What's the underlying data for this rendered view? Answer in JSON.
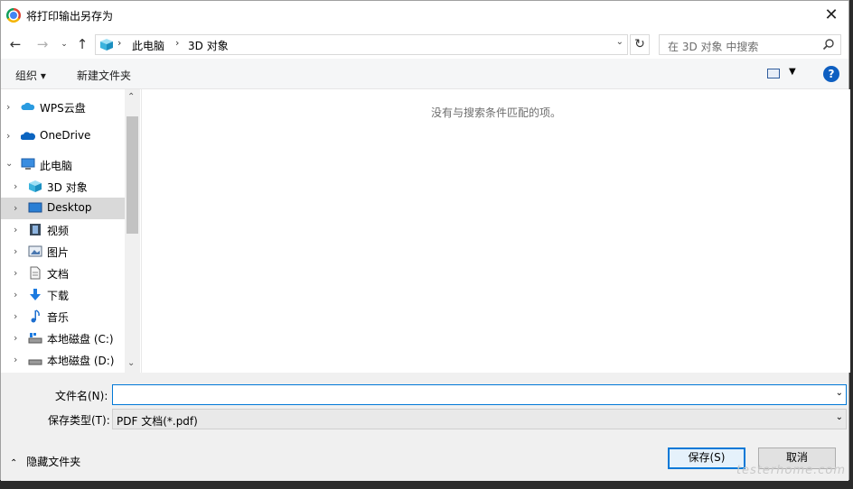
{
  "window": {
    "title": "将打印输出另存为"
  },
  "address": {
    "crumbs": [
      "此电脑",
      "3D 对象"
    ]
  },
  "search": {
    "placeholder": "在 3D 对象 中搜索"
  },
  "toolbar": {
    "organize": "组织 ▾",
    "new_folder": "新建文件夹"
  },
  "tree": {
    "items": [
      {
        "label": "WPS云盘",
        "icon": "cloud-icon"
      },
      {
        "label": "OneDrive",
        "icon": "onedrive-icon"
      },
      {
        "label": "此电脑",
        "icon": "computer-icon"
      },
      {
        "label": "3D 对象",
        "icon": "cube-icon"
      },
      {
        "label": "Desktop",
        "icon": "desktop-icon",
        "selected": true
      },
      {
        "label": "视频",
        "icon": "video-icon"
      },
      {
        "label": "图片",
        "icon": "picture-icon"
      },
      {
        "label": "文档",
        "icon": "document-icon"
      },
      {
        "label": "下载",
        "icon": "download-icon"
      },
      {
        "label": "音乐",
        "icon": "music-icon"
      },
      {
        "label": "本地磁盘 (C:)",
        "icon": "drive-icon"
      },
      {
        "label": "本地磁盘 (D:)",
        "icon": "drive-icon"
      }
    ]
  },
  "content": {
    "empty_message": "没有与搜索条件匹配的项。"
  },
  "form": {
    "filename_label": "文件名(N):",
    "filename_value": "",
    "filetype_label": "保存类型(T):",
    "filetype_value": "PDF 文档(*.pdf)"
  },
  "footer": {
    "hide_folders": "隐藏文件夹",
    "save": "保存(S)",
    "cancel": "取消"
  },
  "watermark": "testerhome.com",
  "colors": {
    "accent": "#0078d7",
    "selected": "#d9d9d9"
  }
}
